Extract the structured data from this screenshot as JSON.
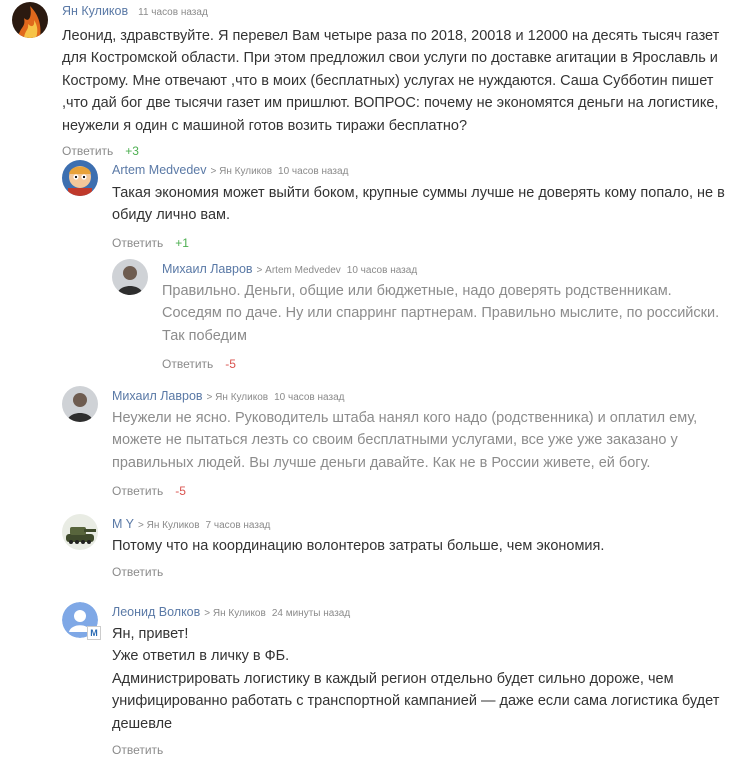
{
  "reply_label": "Ответить",
  "colors": {
    "author": "#5a79a6",
    "positive": "#4caf50",
    "negative": "#d9534f",
    "meta": "#8a8a8a"
  },
  "comments": [
    {
      "author": "Ян Куликов",
      "reply_to": "",
      "time": "11 часов назад",
      "lines": [
        "Леонид, здравствуйте. Я перевел Вам четыре раза по 2018, 20018 и 12000 на десять тысяч газет",
        "для Костромской области. При этом предложил свои услуги по доставке агитации в Ярославль и",
        "Кострому. Мне отвечают ,что в моих (бесплатных) услугах не нуждаются. Саша Субботин пишет",
        ",что дай бог две тысячи газет им пришлют. ВОПРОС: почему не экономятся деньги на логистике,",
        "неужели я один с машиной готов возить тиражи бесплатно?"
      ],
      "score": "+3",
      "avatar": "fire-avatar"
    },
    {
      "author": "Artem Medvedev",
      "reply_to": "> Ян Куликов",
      "time": "10 часов назад",
      "lines": [
        "Такая экономия может выйти боком, крупные суммы лучше не доверять кому попало, не в",
        "обиду лично вам."
      ],
      "score": "+1",
      "avatar": "cartoon-avatar"
    },
    {
      "author": "Михаил Лавров",
      "reply_to": "> Artem Medvedev",
      "time": "10 часов назад",
      "lines": [
        "Правильно. Деньги, общие или бюджетные, надо доверять родственникам.",
        "Соседям по даче. Ну или спарринг партнерам. Правильно мыслите, по российски.",
        "Так победим"
      ],
      "score": "-5",
      "avatar": "person-avatar"
    },
    {
      "author": "Михаил Лавров",
      "reply_to": "> Ян Куликов",
      "time": "10 часов назад",
      "lines": [
        "Неужели не ясно. Руководитель штаба нанял кого надо (родственника) и оплатил ему,",
        "можете не пытаться лезть со своим бесплатными услугами, все уже уже заказано у",
        "правильных людей. Вы лучше деньги давайте. Как не в России живете, ей богу."
      ],
      "score": "-5",
      "avatar": "person-avatar"
    },
    {
      "author": "M Y",
      "reply_to": "> Ян Куликов",
      "time": "7 часов назад",
      "lines": [
        "Потому что на координацию волонтеров затраты больше, чем экономия."
      ],
      "score": "",
      "avatar": "tank-avatar"
    },
    {
      "author": "Леонид Волков",
      "reply_to": "> Ян Куликов",
      "time": "24 минуты назад",
      "lines": [
        "Ян, привет!",
        "Уже ответил в личку в ФБ.",
        "Администрировать логистику в каждый регион отдельно будет сильно дороже, чем",
        "унифицированно работать с транспортной кампанией — даже если сама логистика будет",
        "дешевле"
      ],
      "score": "",
      "avatar": "default-user-avatar"
    }
  ]
}
